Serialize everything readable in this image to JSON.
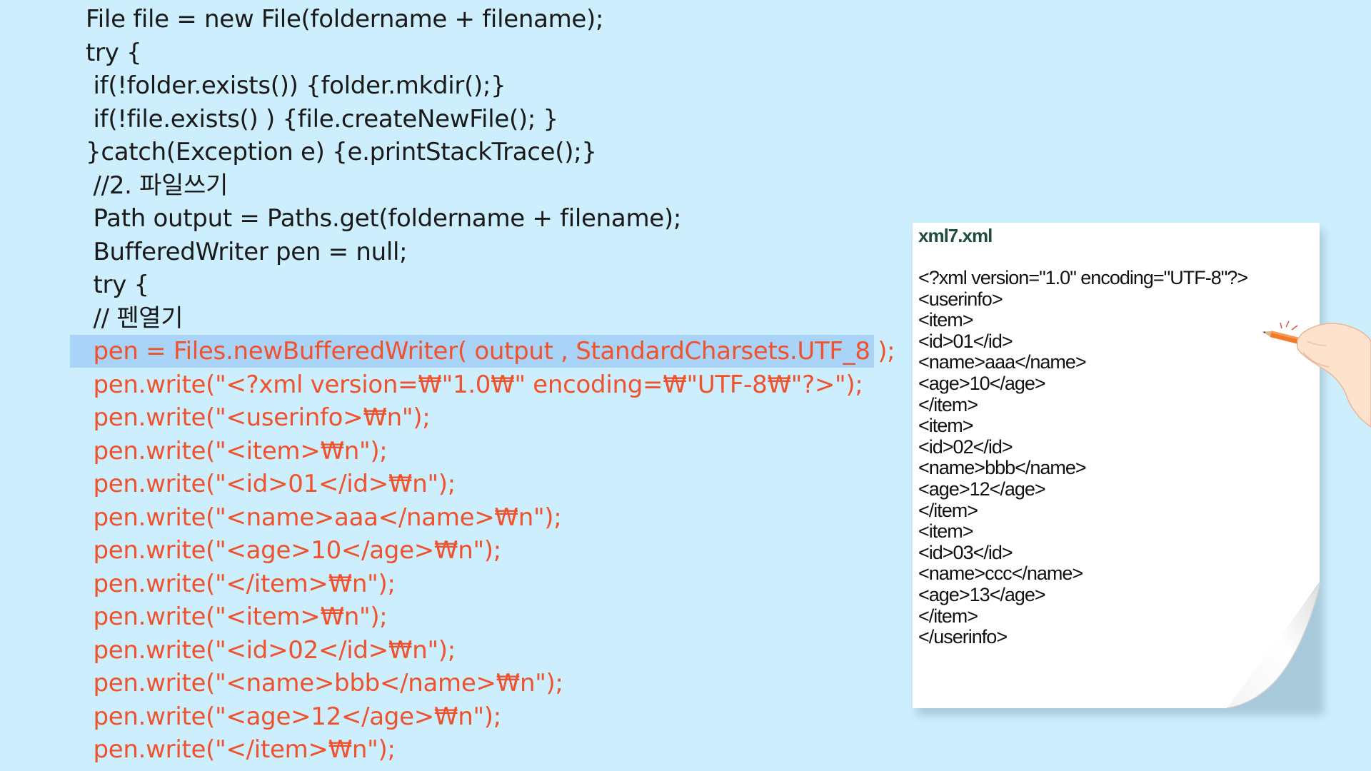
{
  "code": {
    "lines": [
      {
        "text": "File file = new File(foldername + filename);",
        "color": "black"
      },
      {
        "text": "try {",
        "color": "black"
      },
      {
        "text": " if(!folder.exists()) {folder.mkdir();}",
        "color": "black"
      },
      {
        "text": " if(!file.exists() ) {file.createNewFile(); }",
        "color": "black"
      },
      {
        "text": "}catch(Exception e) {e.printStackTrace();}",
        "color": "black"
      },
      {
        "text": " //2. 파일쓰기",
        "color": "black"
      },
      {
        "text": " Path output = Paths.get(foldername + filename);",
        "color": "black"
      },
      {
        "text": " BufferedWriter pen = null;",
        "color": "black"
      },
      {
        "text": " try {",
        "color": "black"
      },
      {
        "text": " // 펜열기",
        "color": "black"
      },
      {
        "text": " pen = Files.newBufferedWriter( output , StandardCharsets.UTF_8 );",
        "color": "red",
        "highlighted": true
      },
      {
        "text": " pen.write(\"<?xml version=₩\"1.0₩\" encoding=₩\"UTF-8₩\"?>\");",
        "color": "red"
      },
      {
        "text": " pen.write(\"<userinfo>₩n\");",
        "color": "red"
      },
      {
        "text": " pen.write(\"<item>₩n\");",
        "color": "red"
      },
      {
        "text": " pen.write(\"<id>01</id>₩n\");",
        "color": "red"
      },
      {
        "text": " pen.write(\"<name>aaa</name>₩n\");",
        "color": "red"
      },
      {
        "text": " pen.write(\"<age>10</age>₩n\");",
        "color": "red"
      },
      {
        "text": " pen.write(\"</item>₩n\");",
        "color": "red"
      },
      {
        "text": " pen.write(\"<item>₩n\");",
        "color": "red"
      },
      {
        "text": " pen.write(\"<id>02</id>₩n\");",
        "color": "red"
      },
      {
        "text": " pen.write(\"<name>bbb</name>₩n\");",
        "color": "red"
      },
      {
        "text": " pen.write(\"<age>12</age>₩n\");",
        "color": "red"
      },
      {
        "text": " pen.write(\"</item>₩n\");",
        "color": "red"
      }
    ]
  },
  "paper": {
    "title": "xml7.xml",
    "xml_lines": [
      "<?xml version=\"1.0\" encoding=\"UTF-8\"?>",
      "<userinfo>",
      "<item>",
      "<id>01</id>",
      "<name>aaa</name>",
      "<age>10</age>",
      "</item>",
      "<item>",
      "<id>02</id>",
      "<name>bbb</name>",
      "<age>12</age>",
      "</item>",
      "<item>",
      "<id>03</id>",
      "<name>ccc</name>",
      "<age>13</age>",
      "</item>",
      "</userinfo>"
    ]
  },
  "colors": {
    "background": "#cdeefd",
    "code_black": "#1a1a1a",
    "code_red": "#f0522d",
    "highlight": "#a9d3f7",
    "paper_title": "#1f4d3a"
  },
  "icons": {
    "hand": "hand-holding-pencil-icon"
  }
}
